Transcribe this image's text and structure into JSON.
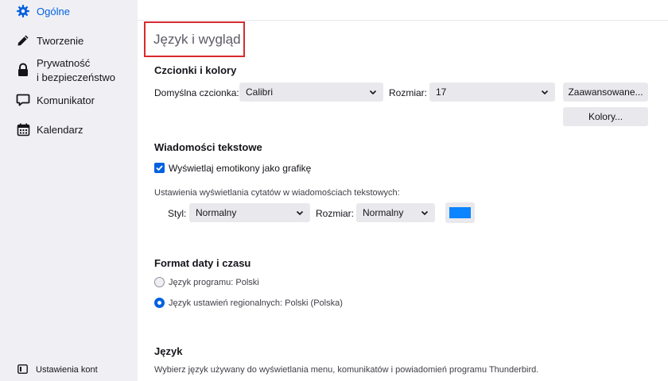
{
  "sidebar": {
    "items": [
      {
        "label": "Ogólne",
        "icon": "gear-icon",
        "selected": true
      },
      {
        "label": "Tworzenie",
        "icon": "pencil-icon"
      },
      {
        "label_line1": "Prywatność",
        "label_line2": "i bezpieczeństwo",
        "icon": "lock-icon"
      },
      {
        "label": "Komunikator",
        "icon": "chat-icon"
      },
      {
        "label": "Kalendarz",
        "icon": "calendar-icon"
      }
    ],
    "footer": {
      "label": "Ustawienia kont",
      "icon": "account-settings-icon"
    }
  },
  "page": {
    "title": "Język i wygląd"
  },
  "fonts": {
    "section_title": "Czcionki i kolory",
    "default_font_label": "Domyślna czcionka:",
    "default_font_value": "Calibri",
    "size_label": "Rozmiar:",
    "size_value": "17",
    "advanced_button": "Zaawansowane...",
    "colors_button": "Kolory..."
  },
  "messages": {
    "section_title": "Wiadomości tekstowe",
    "emoticons_label": "Wyświetlaj emotikony jako grafikę",
    "emoticons_checked": true,
    "quote_settings_label": "Ustawienia wyświetlania cytatów w wiadomościach tekstowych:",
    "style_label": "Styl:",
    "style_value": "Normalny",
    "size_label": "Rozmiar:",
    "size_value": "Normalny",
    "quote_color": "#0a84ff"
  },
  "datetime": {
    "section_title": "Format daty i czasu",
    "option_app_language": "Język programu: Polski",
    "option_regional": "Język ustawień regionalnych: Polski (Polska)",
    "selected": "regional"
  },
  "language": {
    "section_title": "Język",
    "description": "Wybierz język używany do wyświetlania menu, komunikatów i powiadomień programu Thunderbird."
  },
  "colors": {
    "accent": "#0061e0",
    "highlight_border": "#d92a2f",
    "sidebar_bg": "#f0f0f4"
  }
}
